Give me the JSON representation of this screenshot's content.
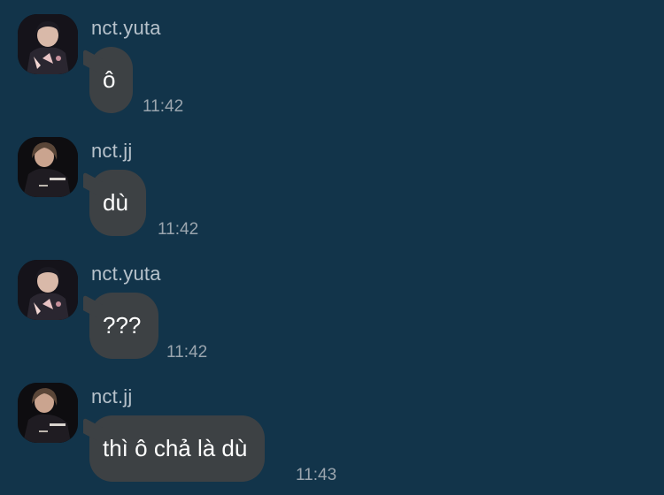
{
  "messages": [
    {
      "sender": "nct.yuta",
      "text": "ô",
      "time": "11:42",
      "avatar": "yuta-avatar"
    },
    {
      "sender": "nct.jj",
      "text": "dù",
      "time": "11:42",
      "avatar": "jj-avatar"
    },
    {
      "sender": "nct.yuta",
      "text": "???",
      "time": "11:42",
      "avatar": "yuta-avatar"
    },
    {
      "sender": "nct.jj",
      "text": "thì ô chả là dù",
      "time": "11:43",
      "avatar": "jj-avatar"
    }
  ],
  "colors": {
    "background": "#12344a",
    "bubble": "#3d4144",
    "sender_name": "#b7c2cb",
    "timestamp": "#9aa5ae",
    "message_text": "#ffffff"
  }
}
